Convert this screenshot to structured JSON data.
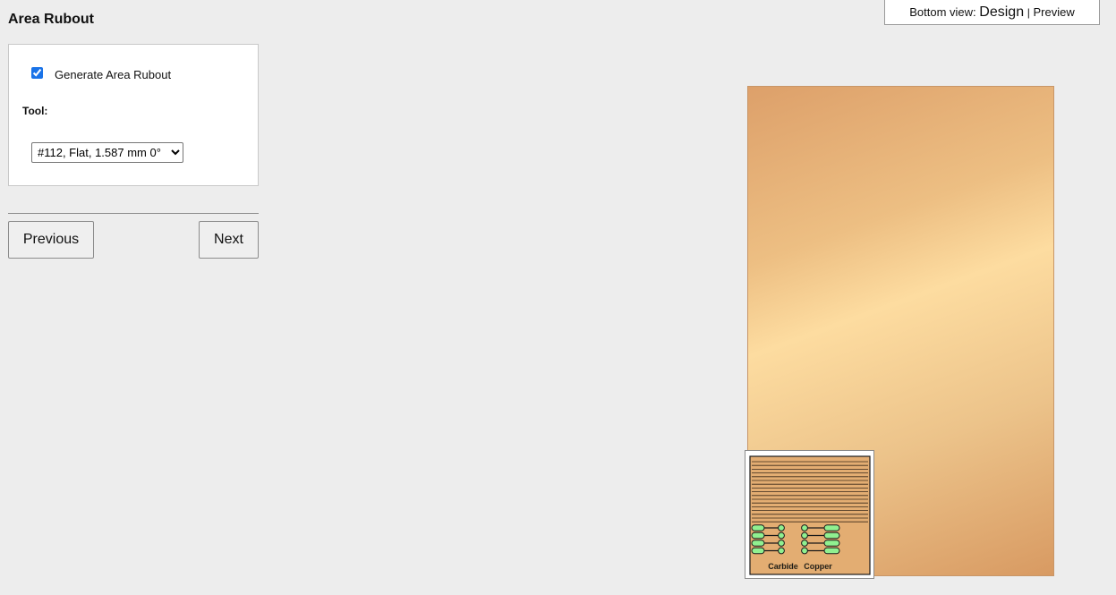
{
  "panel": {
    "title": "Area Rubout",
    "generate_label": "Generate Area Rubout",
    "generate_checked": true,
    "tool_label": "Tool:",
    "tool_selected": "#112, Flat, 1.587 mm 0°"
  },
  "nav": {
    "previous_label": "Previous",
    "next_label": "Next"
  },
  "view_toggle": {
    "prefix": "Bottom view:",
    "design_label": "Design",
    "separator": "|",
    "preview_label": "Preview"
  },
  "thumbnail": {
    "text_left": "Carbide",
    "text_right": "Copper"
  },
  "colors": {
    "copper_light": "#fddca0",
    "copper_dark": "#d89a62",
    "pad_green": "#90f090",
    "accent": "#1a73e8"
  }
}
